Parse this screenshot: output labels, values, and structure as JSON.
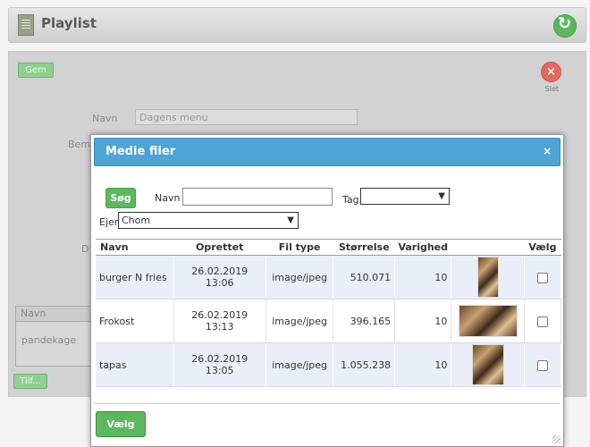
{
  "topbar": {
    "title": "Playlist"
  },
  "panel": {
    "gem_label": "Gem",
    "close_label": "Slet",
    "navn_label": "Navn",
    "navn_value": "Dagens menu",
    "bem_label": "Bem",
    "d_label": "D",
    "table": {
      "header": "Navn",
      "row": "pandekage"
    },
    "tilfoj_label": "Tilf..."
  },
  "modal": {
    "title": "Medie filer",
    "close": "×",
    "search_button": "Søg",
    "navn_label": "Navn",
    "navn_value": "",
    "tag_label": "Tag",
    "tag_value": "",
    "ejer_label": "Ejer",
    "ejer_value": "Chom",
    "columns": [
      "Navn",
      "Oprettet",
      "Fil type",
      "Størrelse",
      "Varighed",
      "",
      "Vælg"
    ],
    "rows": [
      {
        "navn": "burger N fries",
        "oprettet": "26.02.2019 13:06",
        "fil_type": "image/jpeg",
        "stoerrelse": "510.071",
        "varighed": "10",
        "checked": false
      },
      {
        "navn": "Frokost",
        "oprettet": "26.02.2019 13:13",
        "fil_type": "image/jpeg",
        "stoerrelse": "396.165",
        "varighed": "10",
        "checked": false
      },
      {
        "navn": "tapas",
        "oprettet": "26.02.2019 13:05",
        "fil_type": "image/jpeg",
        "stoerrelse": "1.055.238",
        "varighed": "10",
        "checked": false
      }
    ],
    "select_button": "Vælg"
  },
  "colors": {
    "accent_green": "#5cb85c",
    "header_blue": "#4ea3d7",
    "close_red": "#e46a5e"
  }
}
